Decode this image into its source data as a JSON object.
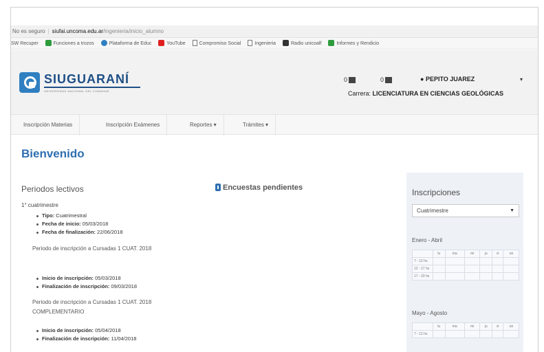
{
  "browser": {
    "security": "No es seguro",
    "host": "siufai.uncoma.edu.ar",
    "path": "/ingenieria/inicio_alumno",
    "bookmarks": [
      {
        "label": "SW Recuper",
        "color": ""
      },
      {
        "label": "Funciones a trozos",
        "color": "#2e9b3c"
      },
      {
        "label": "Plataforma de Educ",
        "color": "#2f7fc1"
      },
      {
        "label": "YouTube",
        "color": "#e02020"
      },
      {
        "label": "Compromiso Social",
        "color": "doc"
      },
      {
        "label": "Ingenieria",
        "color": "doc"
      },
      {
        "label": "Radio unicoalf",
        "color": "#333333"
      },
      {
        "label": "Informes y Rendicio",
        "color": "#2e9b3c"
      }
    ]
  },
  "header": {
    "brand": "SIUGUARANÍ",
    "brand_sub": "UNIVERSIDAD NACIONAL DEL COMAHUE",
    "util_1": "0",
    "util_2": "0",
    "user_name": "PEPITO JUAREZ",
    "career_label": "Carrera:",
    "career_value": "LICENCIATURA EN CIENCIAS GEOLÓGICAS"
  },
  "nav": {
    "items": [
      "Inscripción Materias",
      "Inscripción Exámenes",
      "Reportes ▾",
      "Trámites ▾"
    ]
  },
  "main": {
    "welcome": "Bienvenido",
    "periods_title": "Periodos lectivos",
    "semester": "1° cuatrimestre",
    "info": [
      {
        "k": "Tipo:",
        "v": "Cuatrimestral"
      },
      {
        "k": "Fecha de inicio:",
        "v": "05/03/2018"
      },
      {
        "k": "Fecha de finalización:",
        "v": "22/06/2018"
      }
    ],
    "period_1": "Periodo de inscripción a Cursadas 1 CUAT. 2018",
    "period_1_items": [
      {
        "k": "Inicio de inscripción:",
        "v": "05/03/2018"
      },
      {
        "k": "Finalización de inscripción:",
        "v": "09/03/2018"
      }
    ],
    "period_2": "Periodo de inscripción a Cursadas 1 CUAT. 2018 COMPLEMENTARIO",
    "period_2_items": [
      {
        "k": "Inicio de inscripción:",
        "v": "05/04/2018"
      },
      {
        "k": "Finalización de inscripción:",
        "v": "11/04/2018"
      }
    ],
    "surveys_title": "Encuestas pendientes"
  },
  "panel": {
    "title": "Inscripciones",
    "select_value": "Cuatrimestre",
    "period_a": "Enero - Abril",
    "period_b": "Mayo - Agosto",
    "days": [
      "lu",
      "ma",
      "mi",
      "ju",
      "vi",
      "sá"
    ],
    "rows_a": [
      "7 - 12 hs",
      "12 - 17 hs",
      "17 - 23 hs"
    ],
    "rows_b": [
      "7 - 12 hs"
    ]
  }
}
